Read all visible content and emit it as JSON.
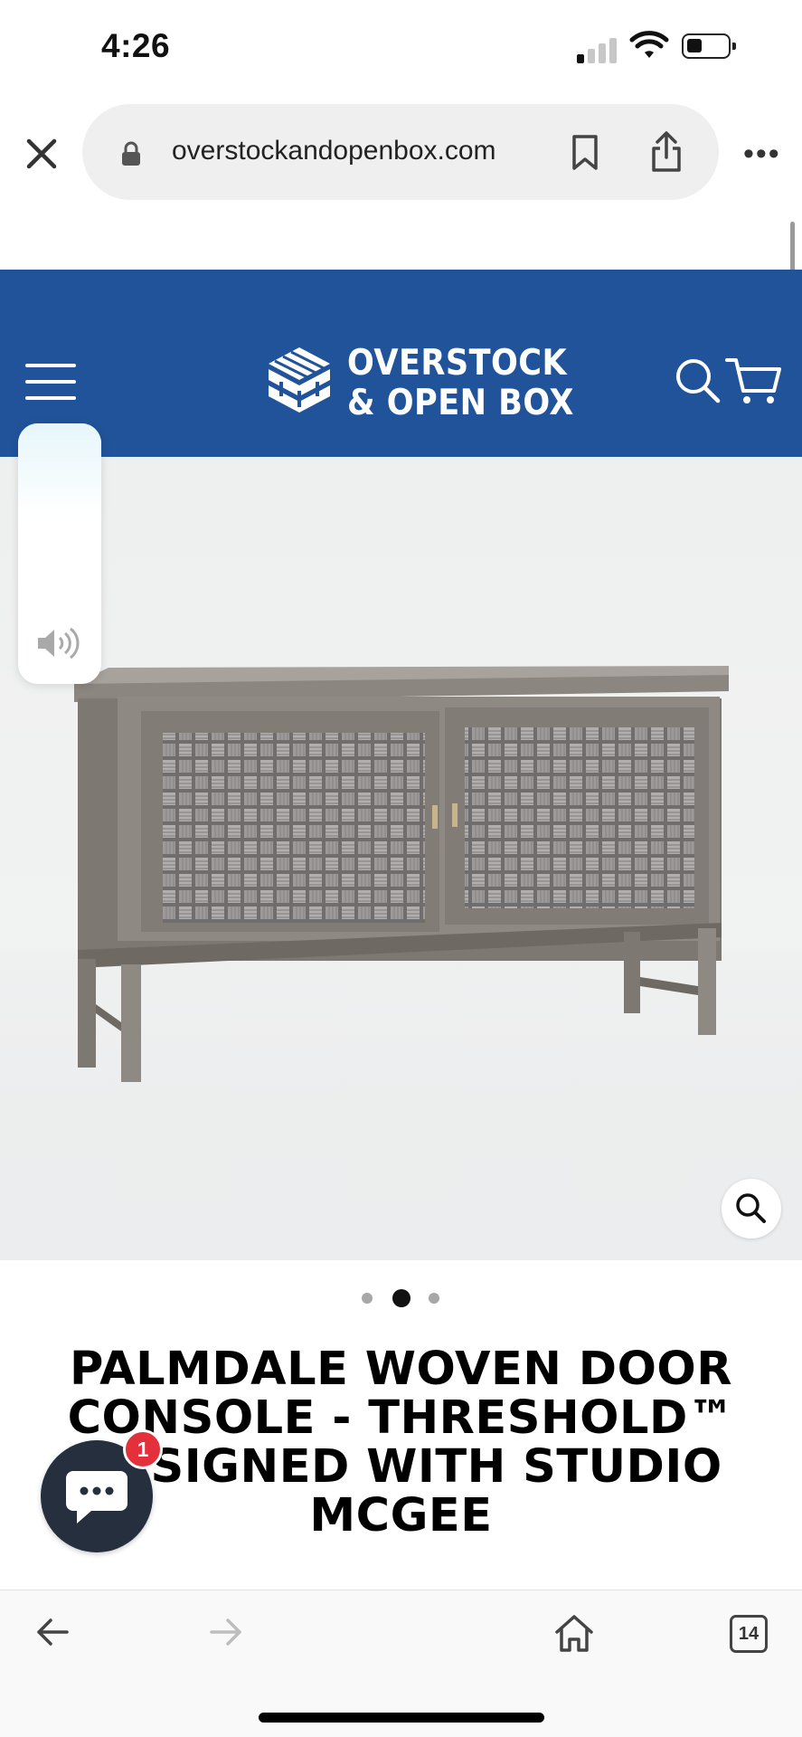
{
  "status_bar": {
    "time": "4:26"
  },
  "browser": {
    "url": "overstockandopenbox.com",
    "tab_count": "14"
  },
  "site": {
    "logo_line1": "OVERSTOCK",
    "logo_line2": "& OPEN BOX"
  },
  "product": {
    "title": "PALMDALE WOVEN DOOR CONSOLE - THRESHOLD™ DESIGNED WITH STUDIO MCGEE",
    "image_count": 3,
    "active_image": 2
  },
  "chat": {
    "badge_count": "1"
  },
  "colors": {
    "header_bg": "#21539a",
    "chat_bg": "#262f3d",
    "badge": "#e3303b"
  },
  "icons": [
    "close-icon",
    "lock-icon",
    "bookmark-icon",
    "share-icon",
    "more-icon",
    "hamburger-icon",
    "search-icon",
    "cart-icon",
    "zoom-icon",
    "volume-icon",
    "chat-icon",
    "back-icon",
    "forward-icon",
    "home-icon",
    "tabs-icon"
  ]
}
